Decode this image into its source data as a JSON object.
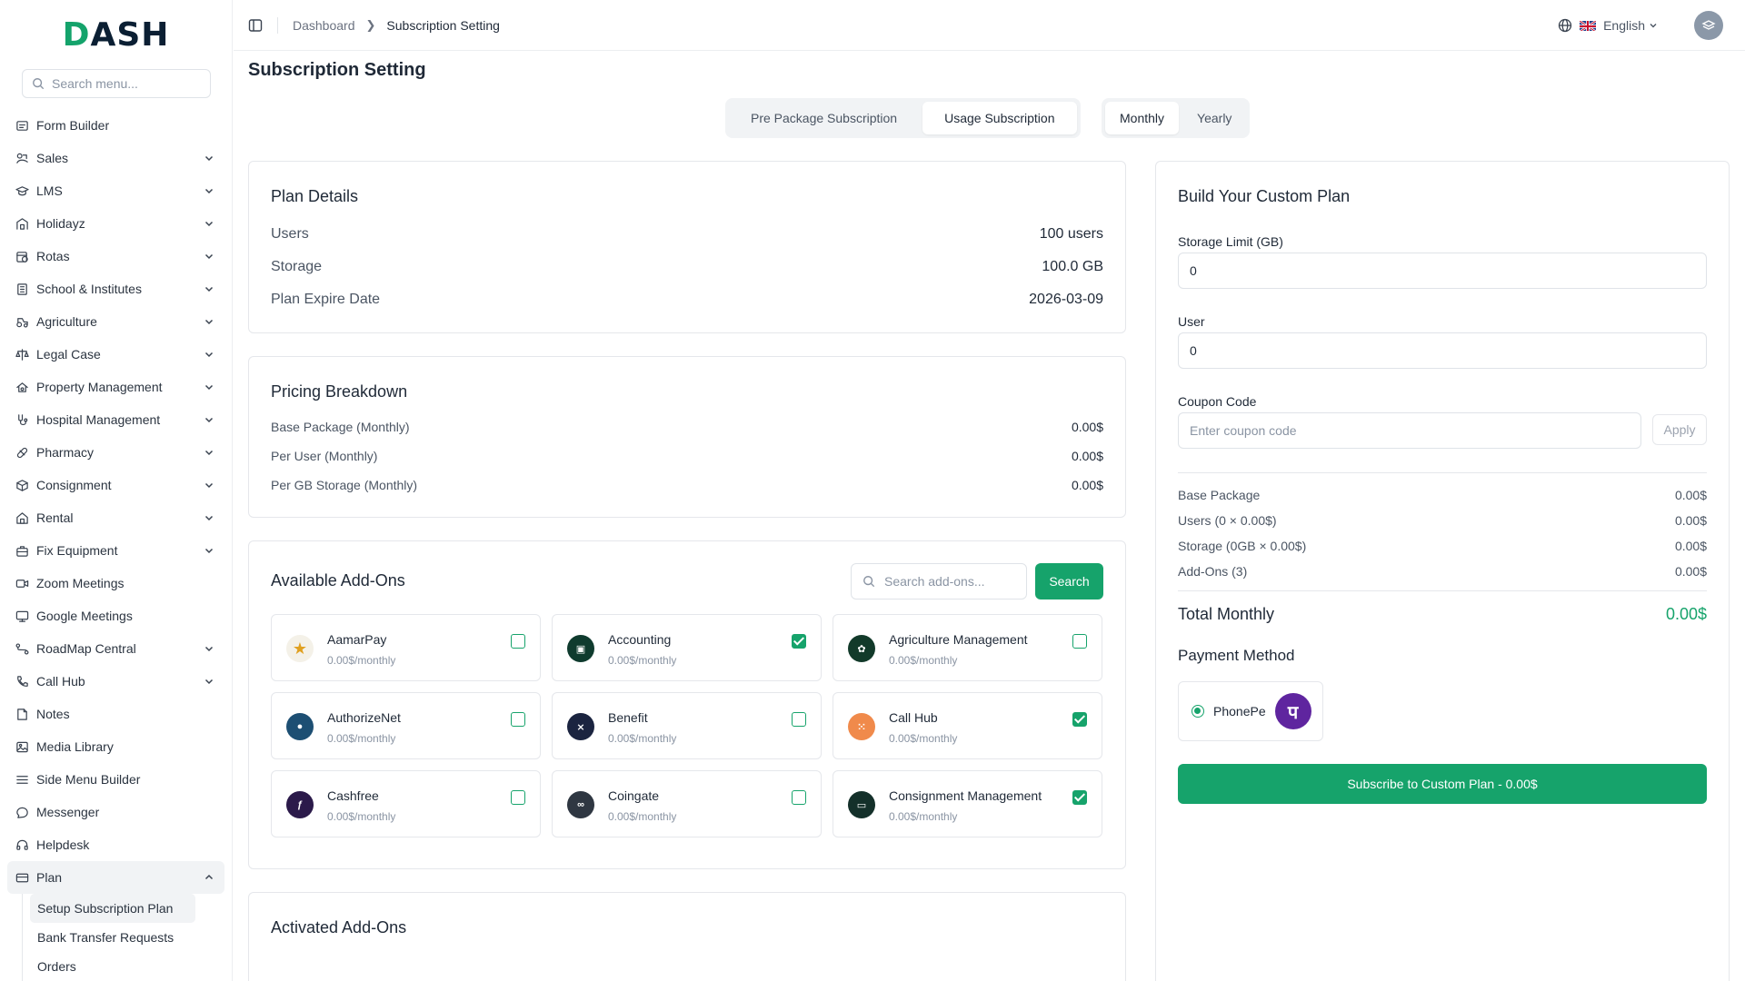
{
  "brand": {
    "logo_text": "DASH"
  },
  "sidebar": {
    "search_placeholder": "Search menu...",
    "items": [
      {
        "label": "Form Builder",
        "icon": "form-icon",
        "chevron": false
      },
      {
        "label": "Sales",
        "icon": "sales-icon",
        "chevron": true
      },
      {
        "label": "LMS",
        "icon": "graduation-cap-icon",
        "chevron": true
      },
      {
        "label": "Holidayz",
        "icon": "hotel-icon",
        "chevron": true
      },
      {
        "label": "Rotas",
        "icon": "calendar-clock-icon",
        "chevron": true
      },
      {
        "label": "School & Institutes",
        "icon": "school-icon",
        "chevron": true
      },
      {
        "label": "Agriculture",
        "icon": "tractor-icon",
        "chevron": true
      },
      {
        "label": "Legal Case",
        "icon": "scale-icon",
        "chevron": true
      },
      {
        "label": "Property Management",
        "icon": "property-icon",
        "chevron": true
      },
      {
        "label": "Hospital Management",
        "icon": "stethoscope-icon",
        "chevron": true
      },
      {
        "label": "Pharmacy",
        "icon": "pill-icon",
        "chevron": true
      },
      {
        "label": "Consignment",
        "icon": "box-icon",
        "chevron": true
      },
      {
        "label": "Rental",
        "icon": "home-icon",
        "chevron": true
      },
      {
        "label": "Fix Equipment",
        "icon": "briefcase-icon",
        "chevron": true
      },
      {
        "label": "Zoom Meetings",
        "icon": "video-icon",
        "chevron": false
      },
      {
        "label": "Google Meetings",
        "icon": "monitor-icon",
        "chevron": false
      },
      {
        "label": "RoadMap Central",
        "icon": "roadmap-icon",
        "chevron": true
      },
      {
        "label": "Call Hub",
        "icon": "phone-icon",
        "chevron": true
      },
      {
        "label": "Notes",
        "icon": "note-icon",
        "chevron": false
      },
      {
        "label": "Media Library",
        "icon": "image-icon",
        "chevron": false
      },
      {
        "label": "Side Menu Builder",
        "icon": "menu-icon",
        "chevron": false
      },
      {
        "label": "Messenger",
        "icon": "chat-icon",
        "chevron": false
      },
      {
        "label": "Helpdesk",
        "icon": "headset-icon",
        "chevron": false
      },
      {
        "label": "Plan",
        "icon": "card-icon",
        "chevron": true
      }
    ],
    "plan_subitems": [
      "Setup Subscription Plan",
      "Bank Transfer Requests",
      "Orders"
    ]
  },
  "topbar": {
    "breadcrumb_home": "Dashboard",
    "breadcrumb_current": "Subscription Setting",
    "language": "English"
  },
  "page": {
    "title": "Subscription Setting"
  },
  "tabs": {
    "type": [
      "Pre Package Subscription",
      "Usage Subscription"
    ],
    "period": [
      "Monthly",
      "Yearly"
    ]
  },
  "plan_details": {
    "title": "Plan Details",
    "rows": [
      {
        "label": "Users",
        "value": "100 users"
      },
      {
        "label": "Storage",
        "value": "100.0 GB"
      },
      {
        "label": "Plan Expire Date",
        "value": "2026-03-09"
      }
    ]
  },
  "pricing": {
    "title": "Pricing Breakdown",
    "rows": [
      {
        "label": "Base Package (Monthly)",
        "value": "0.00$"
      },
      {
        "label": "Per User (Monthly)",
        "value": "0.00$"
      },
      {
        "label": "Per GB Storage (Monthly)",
        "value": "0.00$"
      }
    ]
  },
  "addons": {
    "title": "Available Add-Ons",
    "search_placeholder": "Search add-ons...",
    "search_button": "Search",
    "items": [
      {
        "name": "AamarPay",
        "price": "0.00$/monthly",
        "checked": false,
        "color": "#f4f1e8",
        "glyph": "★"
      },
      {
        "name": "Accounting",
        "price": "0.00$/monthly",
        "checked": true,
        "color": "#0f3b2e",
        "glyph": "▣"
      },
      {
        "name": "Agriculture Management",
        "price": "0.00$/monthly",
        "checked": false,
        "color": "#123a2a",
        "glyph": "✿"
      },
      {
        "name": "AuthorizeNet",
        "price": "0.00$/monthly",
        "checked": false,
        "color": "#1d4f73",
        "glyph": "●"
      },
      {
        "name": "Benefit",
        "price": "0.00$/monthly",
        "checked": false,
        "color": "#1b2440",
        "glyph": "⨯"
      },
      {
        "name": "Call Hub",
        "price": "0.00$/monthly",
        "checked": true,
        "color": "#f08a4b",
        "glyph": "⁙"
      },
      {
        "name": "Cashfree",
        "price": "0.00$/monthly",
        "checked": false,
        "color": "#2b1a4a",
        "glyph": "ƒ"
      },
      {
        "name": "Coingate",
        "price": "0.00$/monthly",
        "checked": false,
        "color": "#2f3742",
        "glyph": "∞"
      },
      {
        "name": "Consignment Management",
        "price": "0.00$/monthly",
        "checked": true,
        "color": "#14302a",
        "glyph": "▭"
      }
    ]
  },
  "activated": {
    "title": "Activated Add-Ons"
  },
  "custom_plan": {
    "title": "Build Your Custom Plan",
    "storage_label": "Storage Limit (GB)",
    "storage_value": "0",
    "user_label": "User",
    "user_value": "0",
    "coupon_label": "Coupon Code",
    "coupon_placeholder": "Enter coupon code",
    "apply_label": "Apply",
    "summary": [
      {
        "label": "Base Package",
        "value": "0.00$"
      },
      {
        "label": "Users (0 × 0.00$)",
        "value": "0.00$"
      },
      {
        "label": "Storage (0GB × 0.00$)",
        "value": "0.00$"
      },
      {
        "label": "Add-Ons (3)",
        "value": "0.00$"
      }
    ],
    "total_label": "Total Monthly",
    "total_value": "0.00$",
    "payment_title": "Payment Method",
    "payment_option": "PhonePe",
    "subscribe_label": "Subscribe to Custom Plan - 0.00$"
  },
  "colors": {
    "accent": "#16a36b",
    "phonepe": "#5f259f"
  }
}
